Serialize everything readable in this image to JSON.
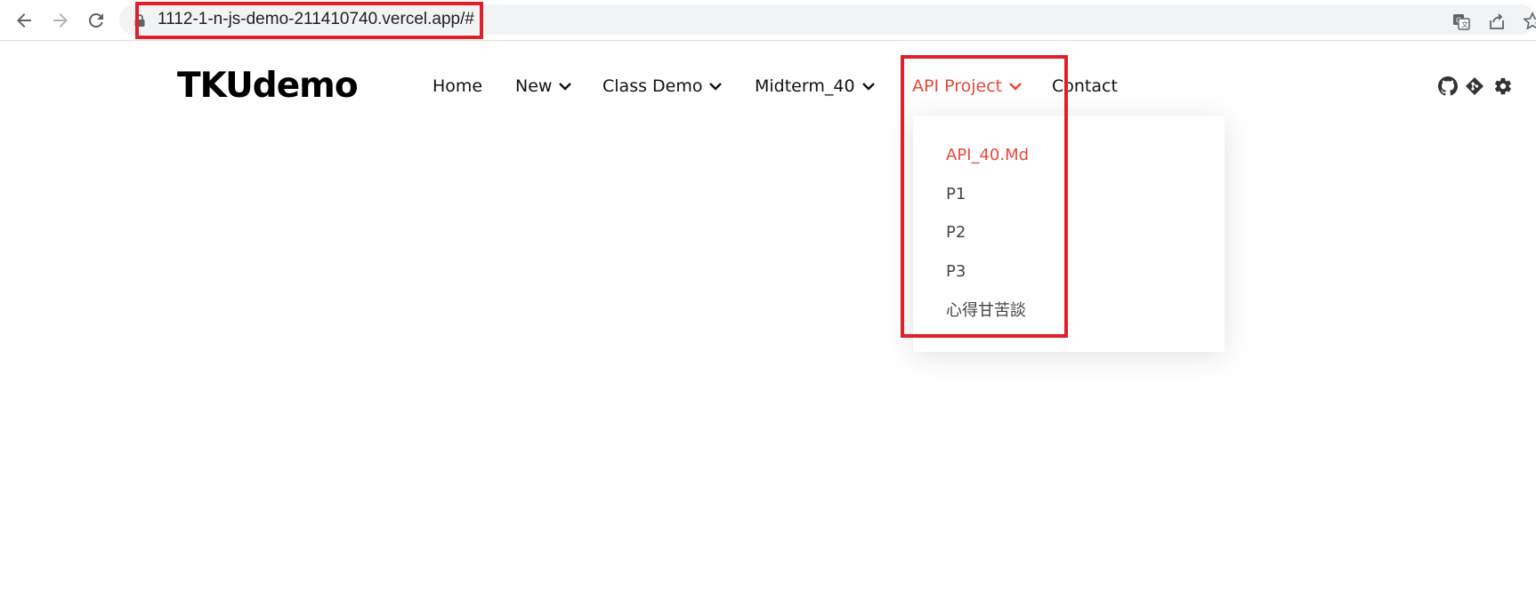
{
  "browser": {
    "url": "1112-1-n-js-demo-211410740.vercel.app/#",
    "icons": [
      "back-icon",
      "forward-icon",
      "reload-icon",
      "lock-icon",
      "translate-icon",
      "share-icon",
      "bookmark-star-icon"
    ]
  },
  "site": {
    "logo": "TKUdemo",
    "nav": {
      "home": "Home",
      "new": "New",
      "class_demo": "Class Demo",
      "midterm": "Midterm_40",
      "api_project": "API Project",
      "contact": "Contact"
    },
    "header_icons": [
      "github-icon",
      "git-icon",
      "gear-icon"
    ],
    "dropdown": {
      "items": [
        "API_40.Md",
        "P1",
        "P2",
        "P3",
        "心得甘苦談"
      ]
    }
  },
  "colors": {
    "accent": "#e8473d",
    "highlight_box": "#e02028"
  }
}
